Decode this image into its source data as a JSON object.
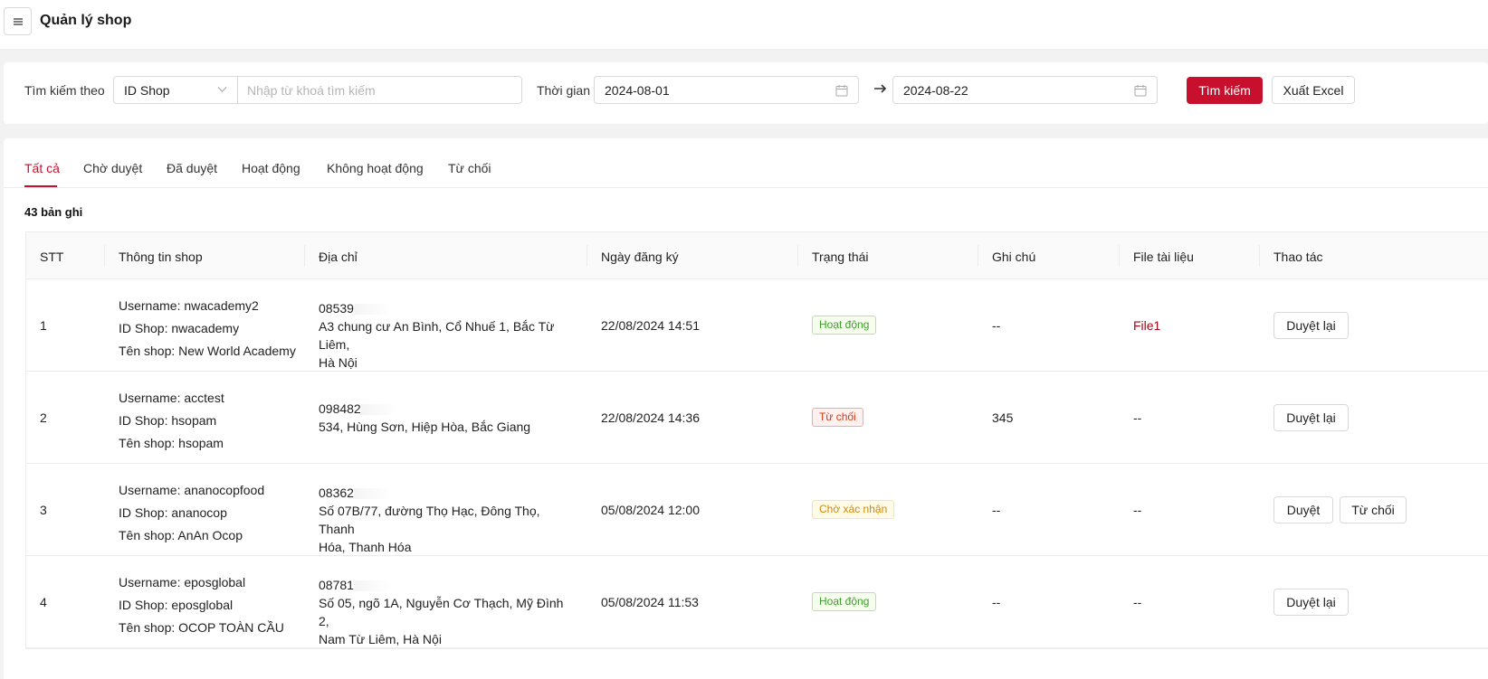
{
  "header": {
    "title": "Quản lý shop"
  },
  "filter": {
    "search_by_label": "Tìm kiếm theo",
    "search_by_value": "ID Shop",
    "search_placeholder": "Nhập từ khoá tìm kiếm",
    "search_value": "",
    "time_label": "Thời gian",
    "date_from": "2024-08-01",
    "date_to": "2024-08-22",
    "search_button": "Tìm kiếm",
    "export_button": "Xuất Excel"
  },
  "tabs": [
    {
      "label": "Tất cả",
      "active": true
    },
    {
      "label": "Chờ duyệt",
      "active": false
    },
    {
      "label": "Đã duyệt",
      "active": false
    },
    {
      "label": "Hoạt động",
      "active": false
    },
    {
      "label": "Không hoạt động",
      "active": false
    },
    {
      "label": "Từ chối",
      "active": false
    }
  ],
  "record_count": "43 bản ghi",
  "table": {
    "columns": [
      "STT",
      "Thông tin shop",
      "Địa chỉ",
      "Ngày đăng ký",
      "Trạng thái",
      "Ghi chú",
      "File tài liệu",
      "Thao tác"
    ],
    "rows": [
      {
        "stt": "1",
        "username": "Username: nwacademy2",
        "shop_id": "ID Shop: nwacademy",
        "shop_name": "Tên shop: New World Academy",
        "phone": "08539",
        "address_l1": "A3 chung cư An Bình, Cổ Nhuế 1, Bắc Từ Liêm,",
        "address_l2": "Hà Nội",
        "date": "22/08/2024 14:51",
        "status": "Hoạt động",
        "note": "--",
        "file": "File1",
        "actions": [
          "Duyệt lại"
        ]
      },
      {
        "stt": "2",
        "username": "Username: acctest",
        "shop_id": "ID Shop: hsopam",
        "shop_name": "Tên shop: hsopam",
        "phone": "098482",
        "address_l1": "534, Hùng Sơn, Hiệp Hòa, Bắc Giang",
        "address_l2": "",
        "date": "22/08/2024 14:36",
        "status": "Từ chối",
        "note": "345",
        "file": "--",
        "actions": [
          "Duyệt lại"
        ]
      },
      {
        "stt": "3",
        "username": "Username: ananocopfood",
        "shop_id": "ID Shop: ananocop",
        "shop_name": "Tên shop: AnAn Ocop",
        "phone": "08362",
        "address_l1": "Số 07B/77, đường Thọ Hạc, Đông Thọ, Thanh",
        "address_l2": "Hóa, Thanh Hóa",
        "date": "05/08/2024 12:00",
        "status": "Chờ xác nhận",
        "note": "--",
        "file": "--",
        "actions": [
          "Duyệt",
          "Từ chối"
        ]
      },
      {
        "stt": "4",
        "username": "Username: eposglobal",
        "shop_id": "ID Shop: eposglobal",
        "shop_name": "Tên shop: OCOP TOÀN CẦU",
        "phone": "08781",
        "address_l1": "Số 05, ngõ 1A, Nguyễn Cơ Thạch, Mỹ Đình 2,",
        "address_l2": "Nam Từ Liêm, Hà Nội",
        "date": "05/08/2024 11:53",
        "status": "Hoạt động",
        "note": "--",
        "file": "--",
        "actions": [
          "Duyệt lại"
        ]
      }
    ]
  },
  "colors": {
    "primary": "#c8102e",
    "status_active": "#3f9b2d",
    "status_rejected": "#d4380d",
    "status_pending": "#d48806"
  },
  "icons": {
    "menu": "menu-icon",
    "dropdown": "chevron-down-icon",
    "calendar": "calendar-icon",
    "range": "arrow-right-icon"
  }
}
